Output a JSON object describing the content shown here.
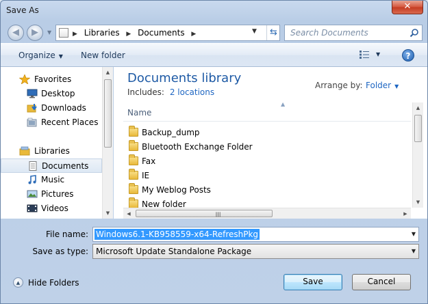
{
  "window": {
    "title": "Save As"
  },
  "address": {
    "crumbs": [
      "Libraries",
      "Documents"
    ]
  },
  "search": {
    "placeholder": "Search Documents"
  },
  "toolbar": {
    "organize_label": "Organize",
    "new_folder_label": "New folder"
  },
  "nav_pane": {
    "items": [
      {
        "label": "Favorites",
        "icon": "star-icon",
        "level": "top"
      },
      {
        "label": "Desktop",
        "icon": "desktop-icon",
        "level": "child"
      },
      {
        "label": "Downloads",
        "icon": "downloads-icon",
        "level": "child"
      },
      {
        "label": "Recent Places",
        "icon": "recent-places-icon",
        "level": "child"
      },
      {
        "label": "Libraries",
        "icon": "libraries-icon",
        "level": "top"
      },
      {
        "label": "Documents",
        "icon": "documents-icon",
        "level": "child",
        "selected": true
      },
      {
        "label": "Music",
        "icon": "music-icon",
        "level": "child"
      },
      {
        "label": "Pictures",
        "icon": "pictures-icon",
        "level": "child"
      },
      {
        "label": "Videos",
        "icon": "videos-icon",
        "level": "child"
      }
    ]
  },
  "content": {
    "title": "Documents library",
    "includes_label": "Includes:",
    "includes_link": "2 locations",
    "arrange_label": "Arrange by:",
    "arrange_value": "Folder",
    "column_name": "Name",
    "items": [
      {
        "label": "Backup_dump"
      },
      {
        "label": "Bluetooth Exchange Folder"
      },
      {
        "label": "Fax"
      },
      {
        "label": "IE"
      },
      {
        "label": "My Weblog Posts"
      },
      {
        "label": "New folder"
      }
    ]
  },
  "form": {
    "filename_label": "File name:",
    "filename_value": "Windows6.1-KB958559-x64-RefreshPkg",
    "type_label": "Save as type:",
    "type_value": "Microsoft Update Standalone Package"
  },
  "footer": {
    "hide_folders_label": "Hide Folders",
    "save_label": "Save",
    "cancel_label": "Cancel"
  },
  "colors": {
    "accent_link": "#1e66c2",
    "title_blue": "#1e5aa5",
    "selection": "#3399ff",
    "close_red": "#c43b21"
  }
}
